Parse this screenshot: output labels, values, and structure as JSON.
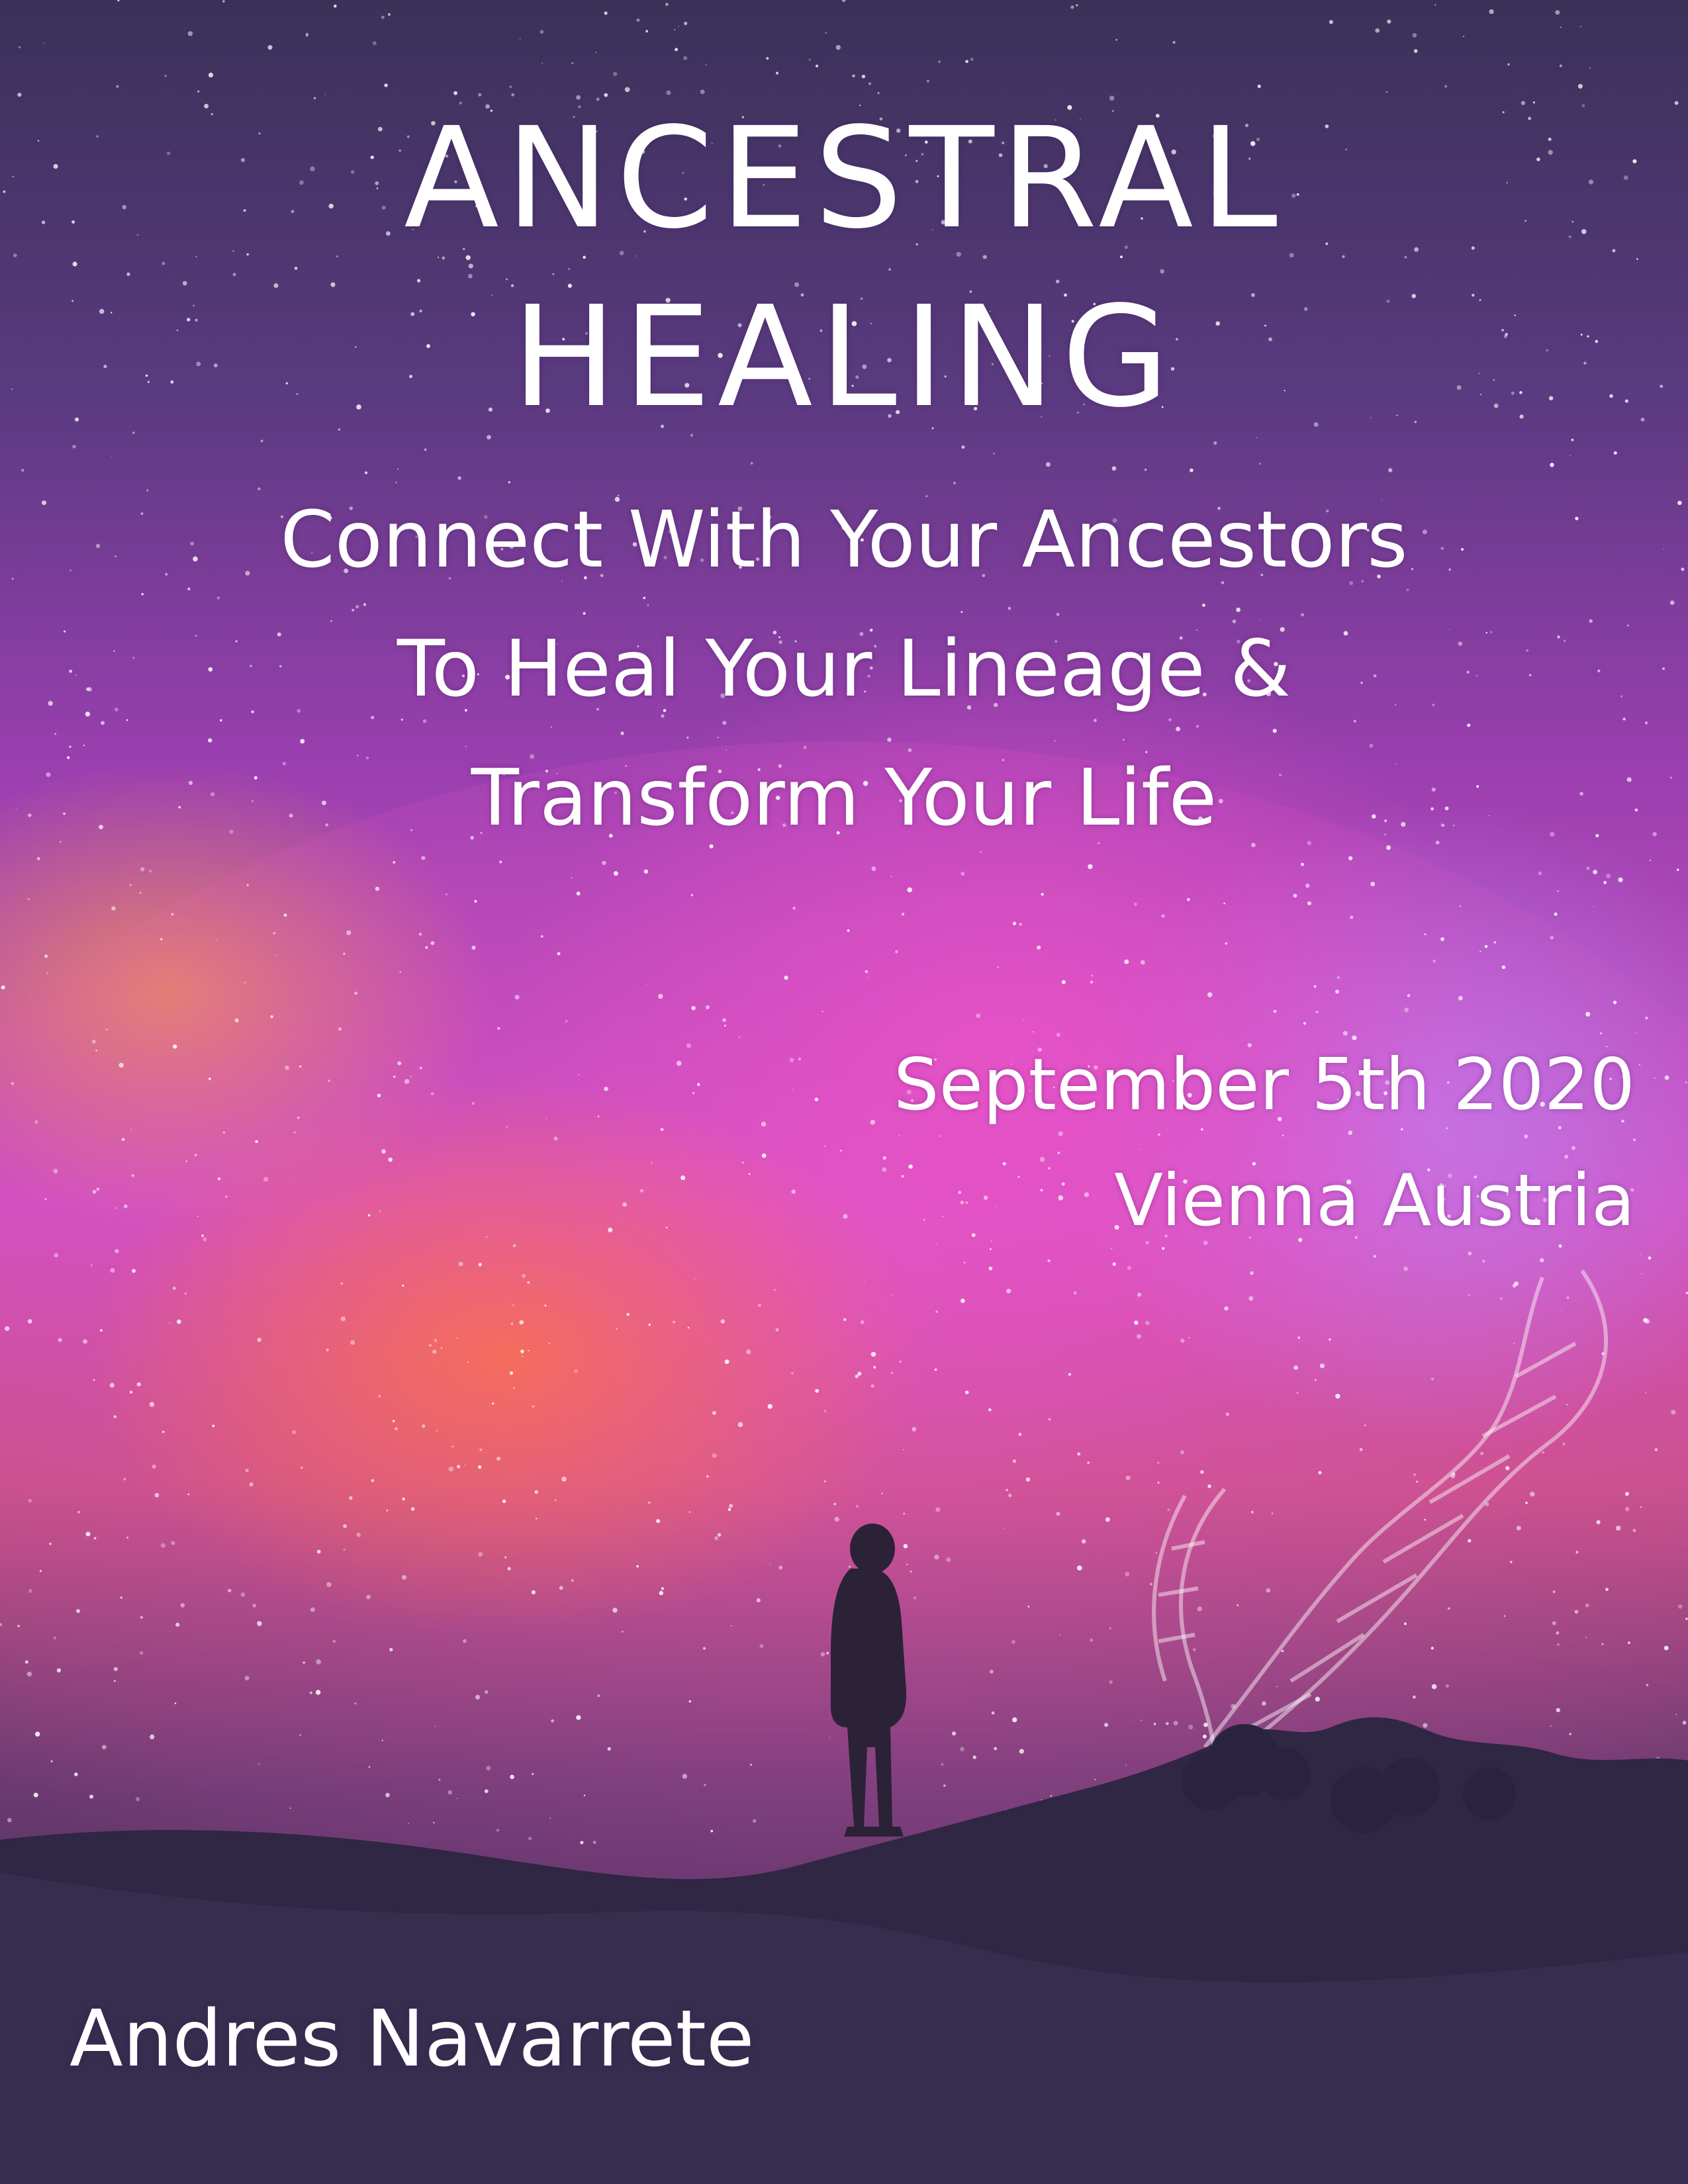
{
  "title": {
    "line1": "ANCESTRAL",
    "line2": "HEALING"
  },
  "subtitle": {
    "line1": "Connect With Your Ancestors",
    "line2": "To Heal Your Lineage &",
    "line3": "Transform Your Life"
  },
  "event": {
    "date": "September 5th 2020",
    "location": "Vienna Austria"
  },
  "author": "Andres Navarrete",
  "colors": {
    "sky_top": "#3a3158",
    "magenta": "#d04fc0",
    "orange_glow": "#ff7828",
    "ground": "#2a2446",
    "text": "#ffffff"
  }
}
